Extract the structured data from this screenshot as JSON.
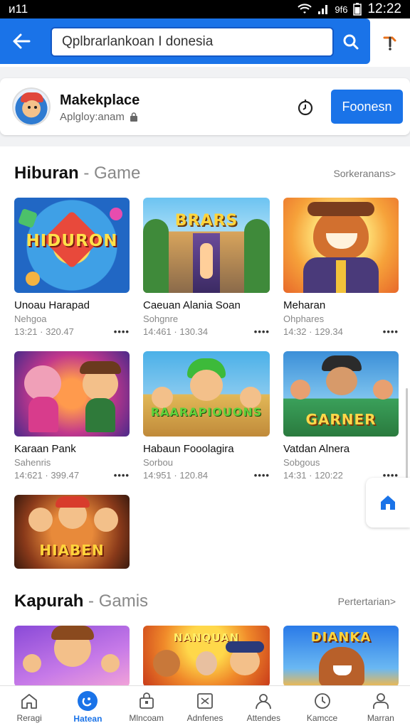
{
  "status": {
    "carrier": "ᴎ11",
    "battery_text": "9f6",
    "time": "12:22"
  },
  "search": {
    "query": "Qplbrarlankoan I donesia"
  },
  "app": {
    "name": "Makekplace",
    "subtitle": "Aplgloy:anam",
    "follow_label": "Foonesn"
  },
  "section1": {
    "title": "Hiburan",
    "subtitle": "- Game",
    "see_all": "Sorkeranans>",
    "cards": [
      {
        "title": "Unoau Harapad",
        "dev": "Nehgoa",
        "meta": "13:21 · 320.47",
        "art": "HIDURON"
      },
      {
        "title": "Caeuan Alania Soan",
        "dev": "Sohgnre",
        "meta": "14:461 · 130.34",
        "art": "BRARS"
      },
      {
        "title": "Meharan",
        "dev": "Ohphares",
        "meta": "14:32 · 129.34",
        "art": ""
      },
      {
        "title": "Karaan Pank",
        "dev": "Sahenris",
        "meta": "14:621 · 399.47",
        "art": ""
      },
      {
        "title": "Habaun Fooolagira",
        "dev": "Sorbou",
        "meta": "14:951 · 120.84",
        "art": "RAARAPIOUONS"
      },
      {
        "title": "Vatdan Alnera",
        "dev": "Sobgous",
        "meta": "14:31 · 120:22",
        "art": "GARNER"
      },
      {
        "art": "HIABEN"
      }
    ]
  },
  "section2": {
    "title": "Kapurah",
    "subtitle": "- Gamis",
    "see_all": "Pertertarian>",
    "cards": [
      {
        "art": ""
      },
      {
        "art": "NANQUAN"
      },
      {
        "art": "DIANKA"
      }
    ]
  },
  "nav": [
    {
      "label": "Reragi",
      "icon": "home-icon",
      "active": false
    },
    {
      "label": "Hatean",
      "icon": "games-icon",
      "active": true
    },
    {
      "label": "Mlncoam",
      "icon": "bag-icon",
      "active": false
    },
    {
      "label": "Adnfenes",
      "icon": "grid-icon",
      "active": false
    },
    {
      "label": "Attendes",
      "icon": "person-icon",
      "active": false
    },
    {
      "label": "Kamcce",
      "icon": "clock-icon",
      "active": false
    },
    {
      "label": "Marran",
      "icon": "account-icon",
      "active": false
    }
  ],
  "colors": {
    "accent": "#1a73e8",
    "brand_dark": "#1559c5"
  }
}
